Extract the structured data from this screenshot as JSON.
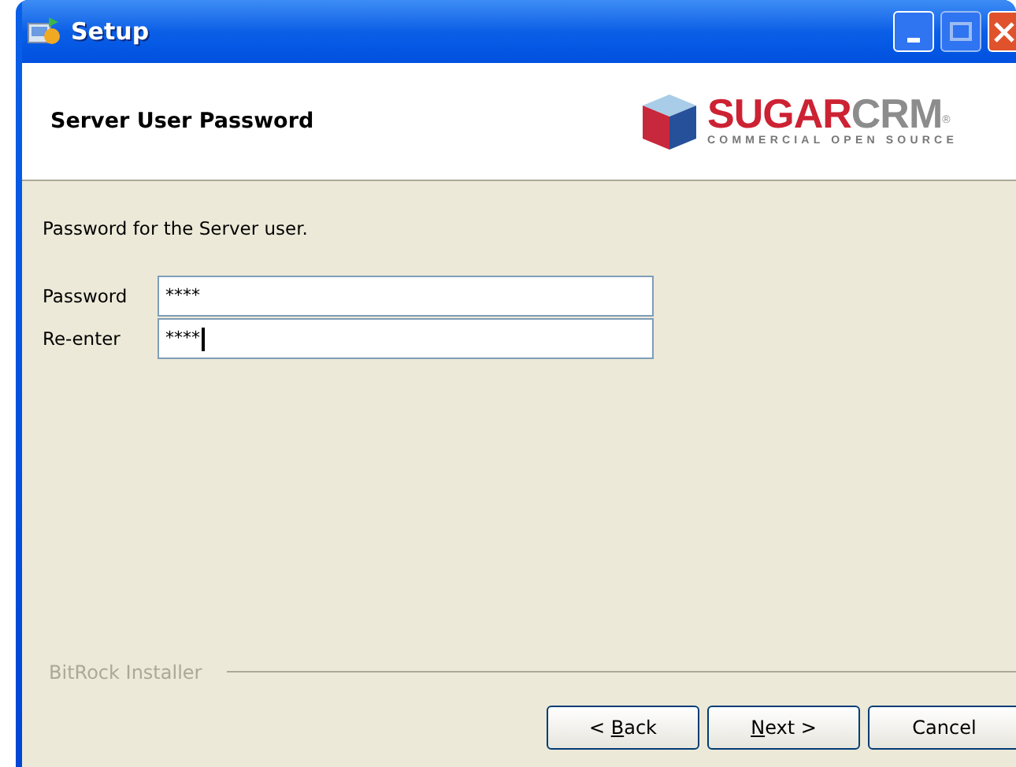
{
  "window": {
    "title": "Setup"
  },
  "header": {
    "title": "Server User Password",
    "logo": {
      "brand_first": "SUGAR",
      "brand_second": "CRM",
      "registered": "®",
      "tagline": "COMMERCIAL OPEN SOURCE"
    }
  },
  "instruction": "Password for the Server user.",
  "fields": [
    {
      "label": "Password",
      "value": "****",
      "focused": false
    },
    {
      "label": "Re-enter",
      "value": "****",
      "focused": true
    }
  ],
  "footer": {
    "brand": "BitRock Installer"
  },
  "buttons": [
    {
      "prefix": "< ",
      "access_key": "B",
      "rest": "ack"
    },
    {
      "access_key": "N",
      "rest": "ext >"
    },
    {
      "prefix": "Cancel"
    }
  ]
}
